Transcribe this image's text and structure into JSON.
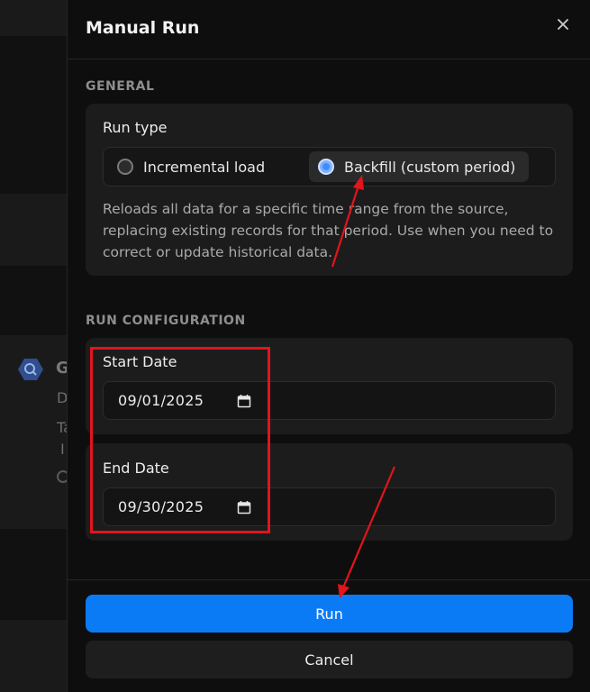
{
  "background": {
    "title_fragment": "G",
    "line1_fragment": "D",
    "line2_fragment": "Ta",
    "line3_fragment": "I"
  },
  "dialog": {
    "title": "Manual Run",
    "close_icon": "close-icon"
  },
  "general": {
    "section_label": "GENERAL",
    "run_type_label": "Run type",
    "options": [
      {
        "label": "Incremental load",
        "selected": false
      },
      {
        "label": "Backfill (custom period)",
        "selected": true
      }
    ],
    "description": "Reloads all data for a specific time range from the source, replacing existing records for that period. Use when you need to correct or update historical data."
  },
  "run_configuration": {
    "section_label": "RUN CONFIGURATION",
    "start_date": {
      "label": "Start Date",
      "value": "09/01/2025",
      "icon": "calendar-icon"
    },
    "end_date": {
      "label": "End Date",
      "value": "09/30/2025",
      "icon": "calendar-icon"
    }
  },
  "footer": {
    "run_label": "Run",
    "cancel_label": "Cancel"
  },
  "colors": {
    "accent": "#0b7bf5",
    "annotation": "#e3141b"
  }
}
